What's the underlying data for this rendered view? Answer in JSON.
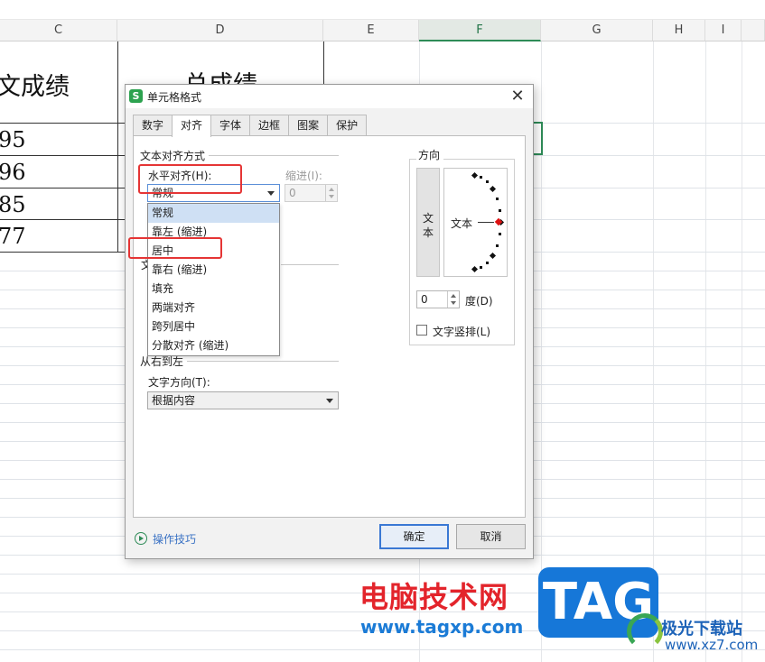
{
  "sheet": {
    "columns": [
      "C",
      "D",
      "E",
      "F",
      "G",
      "H",
      "I"
    ],
    "selected_column": "F",
    "header_cell_c": "文成绩",
    "header_cell_d": "总成绩",
    "values": [
      "95",
      "96",
      "85",
      "77"
    ]
  },
  "dialog": {
    "title": "单元格格式",
    "close_glyph": "✕",
    "app_icon_letter": "S",
    "tabs": [
      "数字",
      "对齐",
      "字体",
      "边框",
      "图案",
      "保护"
    ],
    "active_tab": "对齐",
    "text_alignment": {
      "group_title": "文本对齐方式",
      "horizontal_label": "水平对齐(H):",
      "horizontal_value": "常规",
      "indent_label": "缩进(I):",
      "indent_value": "0",
      "horizontal_options": [
        "常规",
        "靠左 (缩进)",
        "居中",
        "靠右 (缩进)",
        "填充",
        "两端对齐",
        "跨列居中",
        "分散对齐 (缩进)"
      ],
      "highlighted_option": "常规"
    },
    "text_control_partial": "文",
    "rtl": {
      "group_title": "从右到左",
      "direction_label": "文字方向(T):",
      "direction_value": "根据内容"
    },
    "orientation": {
      "group_title": "方向",
      "vertical_text": [
        "文",
        "本"
      ],
      "dial_text": "文本",
      "degree_value": "0",
      "degree_label": "度(D)",
      "vertical_stack_label": "文字竖排(L)",
      "vertical_stack_checked": false
    },
    "footer": {
      "tips_link": "操作技巧",
      "ok_label": "确定",
      "cancel_label": "取消"
    }
  },
  "watermark": {
    "site_cn": "电脑技术网",
    "site_url": "www.tagxp.com",
    "tag_text": "TAG",
    "site2_cn": "极光下载站",
    "site2_url": "www.xz7.com"
  },
  "colors": {
    "accent_green": "#2e8b57",
    "annotation_red": "#e53535",
    "primary_button_border": "#3a78d4",
    "dropdown_highlight": "#cfe0f4"
  }
}
